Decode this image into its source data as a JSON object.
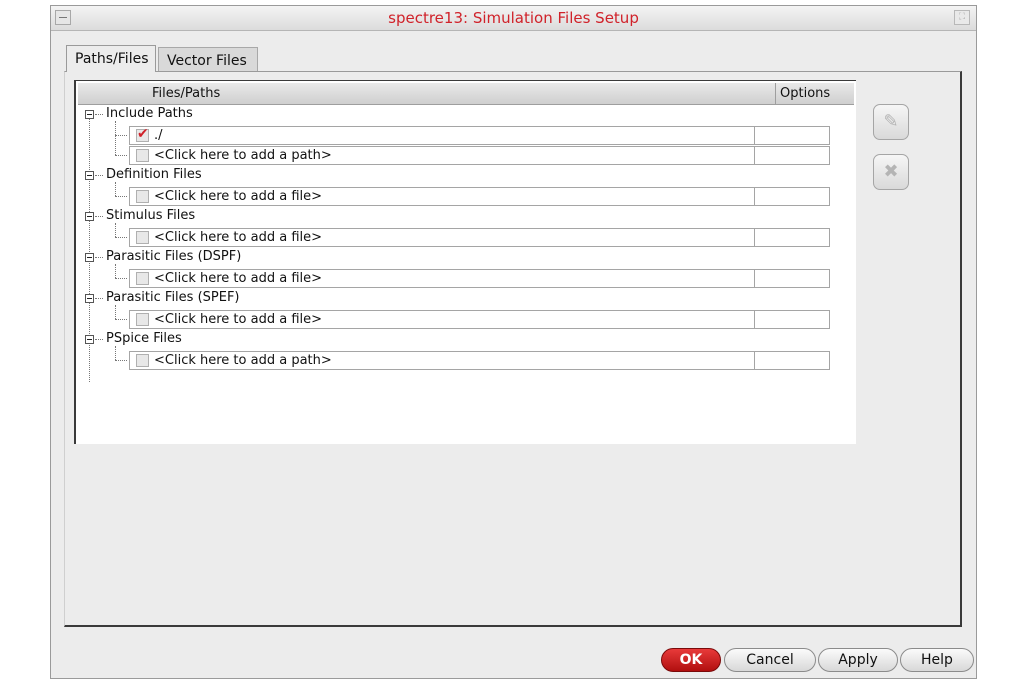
{
  "window": {
    "title": "spectre13: Simulation Files Setup"
  },
  "tabs": [
    {
      "label": "Paths/Files",
      "active": true
    },
    {
      "label": "Vector Files",
      "active": false
    }
  ],
  "table": {
    "headers": {
      "files_paths": "Files/Paths",
      "options": "Options"
    },
    "categories": [
      {
        "label": "Include Paths",
        "items": [
          {
            "text": "./",
            "checked": true
          },
          {
            "text": "<Click here to add a path>",
            "checked": false
          }
        ]
      },
      {
        "label": "Definition Files",
        "items": [
          {
            "text": "<Click here to add a file>",
            "checked": false
          }
        ]
      },
      {
        "label": "Stimulus Files",
        "items": [
          {
            "text": "<Click here to add a file>",
            "checked": false
          }
        ]
      },
      {
        "label": "Parasitic Files (DSPF)",
        "items": [
          {
            "text": "<Click here to add a file>",
            "checked": false
          }
        ]
      },
      {
        "label": "Parasitic Files (SPEF)",
        "items": [
          {
            "text": "<Click here to add a file>",
            "checked": false
          }
        ]
      },
      {
        "label": "PSpice Files",
        "items": [
          {
            "text": "<Click here to add a path>",
            "checked": false
          }
        ]
      }
    ]
  },
  "side_buttons": {
    "edit_icon": "edit-icon",
    "delete_icon": "delete-icon"
  },
  "buttons": {
    "ok": "OK",
    "cancel": "Cancel",
    "apply": "Apply",
    "help": "Help"
  },
  "colors": {
    "title_text": "#d0222a",
    "ok_button": "#c81a1a",
    "check_mark": "#d0222a"
  }
}
